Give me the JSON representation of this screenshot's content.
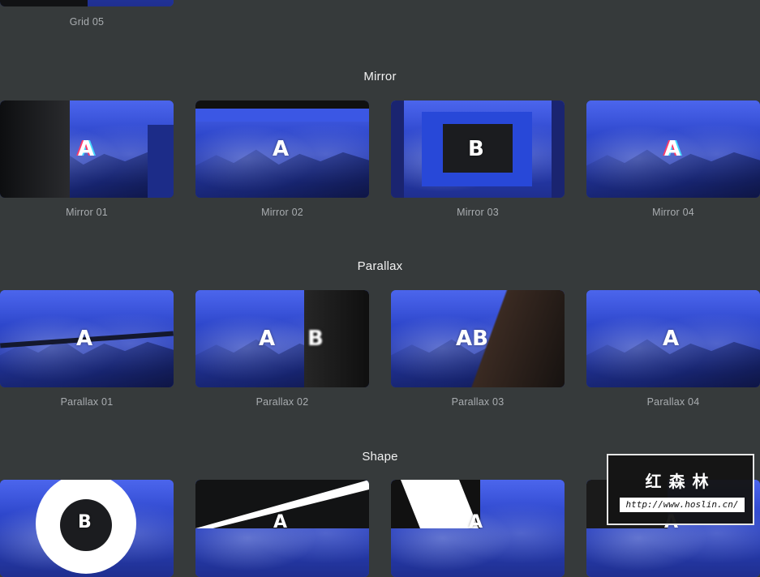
{
  "top_row": {
    "caption": "Grid 05"
  },
  "sections": {
    "mirror": {
      "title": "Mirror",
      "items": [
        {
          "caption": "Mirror 01",
          "letter": "A"
        },
        {
          "caption": "Mirror 02",
          "letter": "A"
        },
        {
          "caption": "Mirror 03",
          "letter": "B"
        },
        {
          "caption": "Mirror 04",
          "letter": "A"
        }
      ]
    },
    "parallax": {
      "title": "Parallax",
      "items": [
        {
          "caption": "Parallax 01",
          "letter": "A"
        },
        {
          "caption": "Parallax 02",
          "letter": "A",
          "letter2": "B"
        },
        {
          "caption": "Parallax 03",
          "letter": "AB"
        },
        {
          "caption": "Parallax 04",
          "letter": "A"
        }
      ]
    },
    "shape": {
      "title": "Shape",
      "items": [
        {
          "letter": "B"
        },
        {
          "letter": "A"
        },
        {
          "letter": "A"
        },
        {
          "letter": "A"
        }
      ]
    }
  },
  "watermark": {
    "title": "红森林",
    "url": "http://www.hoslin.cn/"
  },
  "colors": {
    "background": "#363a3b",
    "accent_blue": "#2c44c9",
    "caption": "#a9adb0"
  }
}
